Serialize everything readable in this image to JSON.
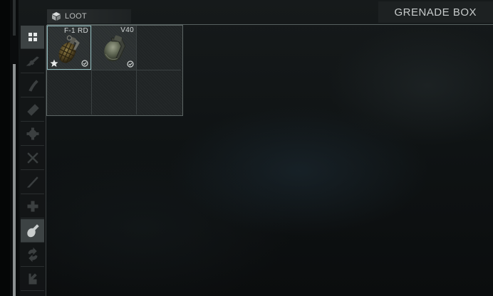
{
  "header": {
    "loot_label": "LOOT",
    "container_title": "GRENADE BOX"
  },
  "filters": [
    {
      "icon": "grid-icon",
      "state": "active"
    },
    {
      "icon": "rifle-icon",
      "state": "dim"
    },
    {
      "icon": "magazine-icon",
      "state": "dim"
    },
    {
      "icon": "ammo-icon",
      "state": "dim"
    },
    {
      "icon": "gear-icon",
      "state": "dim"
    },
    {
      "icon": "crossed-tools-icon",
      "state": "dim"
    },
    {
      "icon": "knife-icon",
      "state": "dim"
    },
    {
      "icon": "medical-cross-icon",
      "state": "dim"
    },
    {
      "icon": "grenade-icon",
      "state": "on"
    },
    {
      "icon": "swap-icon",
      "state": "dim"
    },
    {
      "icon": "barter-icon",
      "state": "dim"
    }
  ],
  "grid": {
    "columns": 3,
    "rows": 2,
    "items": [
      {
        "name": "F-1 RD",
        "icon": "f1-grenade-icon",
        "favorite": true,
        "checked": true,
        "selected": true
      },
      {
        "name": "V40",
        "icon": "v40-grenade-icon",
        "favorite": false,
        "checked": true,
        "selected": false
      }
    ]
  },
  "colors": {
    "accent": "#8fb9bb",
    "text": "#c7cbcb",
    "active_filter": "#3d4344"
  }
}
